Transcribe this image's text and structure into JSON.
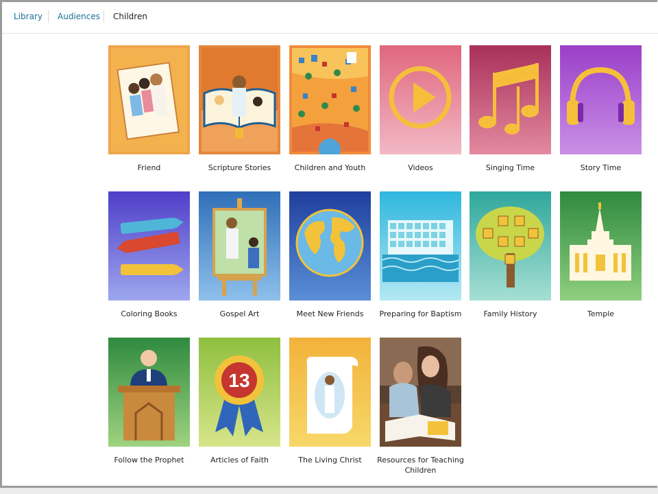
{
  "breadcrumb": {
    "items": [
      "Library",
      "Audiences",
      "Children"
    ]
  },
  "tiles": [
    {
      "label": "Friend",
      "icon": "friend-magazine-icon"
    },
    {
      "label": "Scripture Stories",
      "icon": "scripture-book-icon"
    },
    {
      "label": "Children and Youth",
      "icon": "village-map-icon"
    },
    {
      "label": "Videos",
      "icon": "play-icon"
    },
    {
      "label": "Singing Time",
      "icon": "music-note-icon"
    },
    {
      "label": "Story Time",
      "icon": "headphones-icon"
    },
    {
      "label": "Coloring Books",
      "icon": "crayons-icon"
    },
    {
      "label": "Gospel Art",
      "icon": "easel-icon"
    },
    {
      "label": "Meet New Friends",
      "icon": "globe-icon"
    },
    {
      "label": "Preparing for Baptism",
      "icon": "calendar-water-icon"
    },
    {
      "label": "Family History",
      "icon": "family-tree-icon"
    },
    {
      "label": "Temple",
      "icon": "temple-icon"
    },
    {
      "label": "Follow the Prophet",
      "icon": "prophet-pulpit-icon"
    },
    {
      "label": "Articles of Faith",
      "icon": "ribbon-13-icon"
    },
    {
      "label": "The Living Christ",
      "icon": "scroll-icon"
    },
    {
      "label": "Resources for Teaching Children",
      "icon": "photo-reading-icon"
    }
  ],
  "badge_number": "13"
}
